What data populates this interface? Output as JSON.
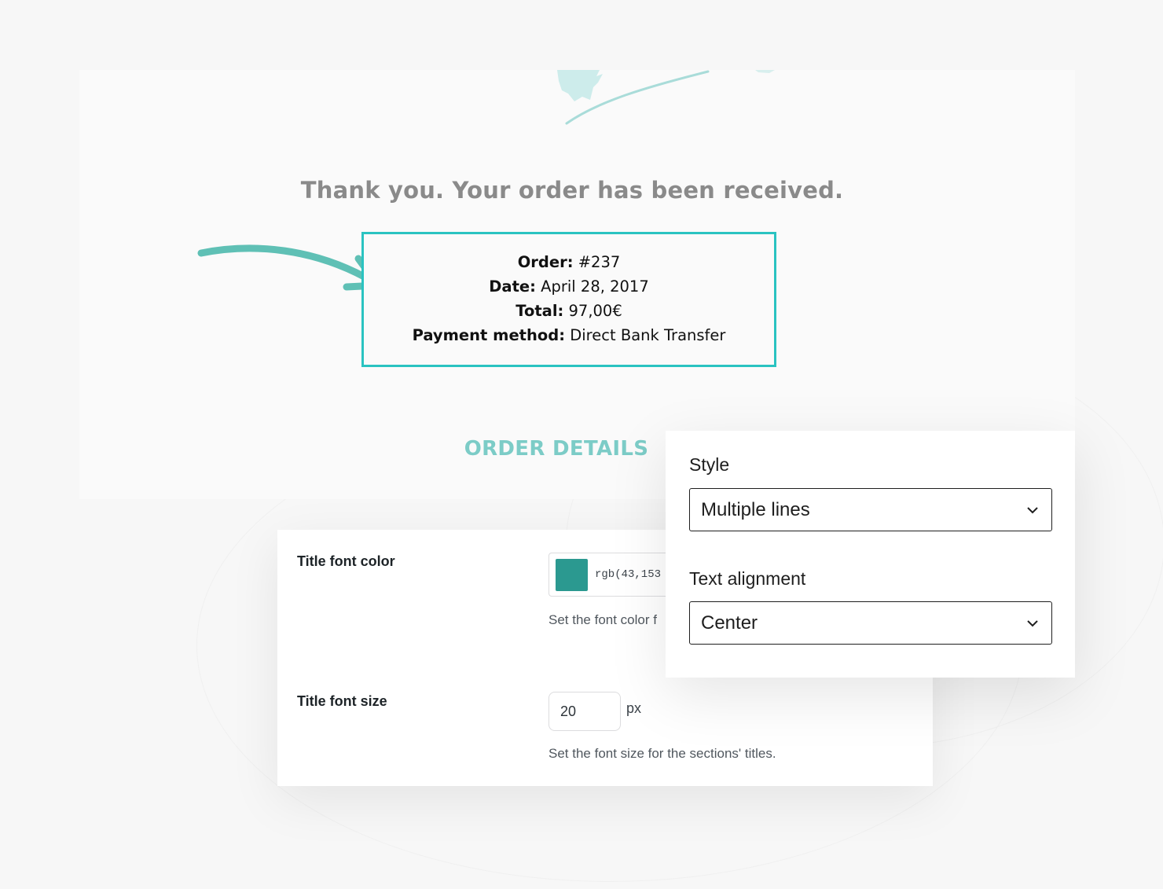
{
  "preview": {
    "thank_you": "Thank you. Your order has been received.",
    "order": {
      "order_label": "Order:",
      "order_value": "#237",
      "date_label": "Date:",
      "date_value": "April 28, 2017",
      "total_label": "Total:",
      "total_value": "97,00€",
      "payment_label": "Payment method:",
      "payment_value": "Direct Bank Transfer"
    },
    "section_title": "ORDER DETAILS",
    "accent_color": "#2ac3c1",
    "section_title_color": "#7cccc7"
  },
  "settings": {
    "title_font_color": {
      "label": "Title font color",
      "swatch_color": "#2b9990",
      "value": "rgb(43,153",
      "help": "Set the font color f"
    },
    "title_font_size": {
      "label": "Title font size",
      "value": "20",
      "unit": "px",
      "help": "Set the font size for the sections' titles."
    }
  },
  "style_panel": {
    "style_label": "Style",
    "style_value": "Multiple lines",
    "alignment_label": "Text alignment",
    "alignment_value": "Center",
    "icon": "chevron-down-icon"
  }
}
